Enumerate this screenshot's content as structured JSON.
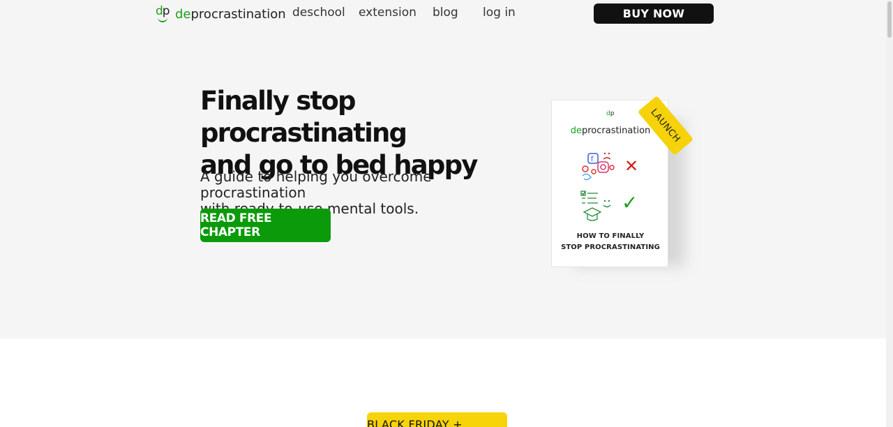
{
  "header": {
    "logo_mark_d": "d",
    "logo_mark_p": "p",
    "logo_prefix": "de",
    "logo_suffix": "procrastination",
    "nav": [
      "deschool",
      "extension",
      "blog",
      "log in"
    ],
    "buy_label": "BUY NOW"
  },
  "hero": {
    "title_line1": "Finally stop procrastinating",
    "title_line2": "and go to bed happy",
    "subtitle_line1": "A guide to helping you overcome procrastination",
    "subtitle_line2": "with ready-to-use mental tools.",
    "cta_label": "READ FREE CHAPTER"
  },
  "book": {
    "mark_d": "d",
    "mark_p": "p",
    "brand_prefix": "de",
    "brand_suffix": "procrastination",
    "title_line1": "HOW TO FINALLY",
    "title_line2": "STOP PROCRASTINATING",
    "badge": "LAUNCH"
  },
  "promo": {
    "badge": "BLACK FRIDAY + LAUNCH"
  },
  "colors": {
    "brand_green": "#1a9f1a",
    "cta_green": "#0a9a0a",
    "badge_yellow": "#f5d20a",
    "dark": "#111111"
  }
}
